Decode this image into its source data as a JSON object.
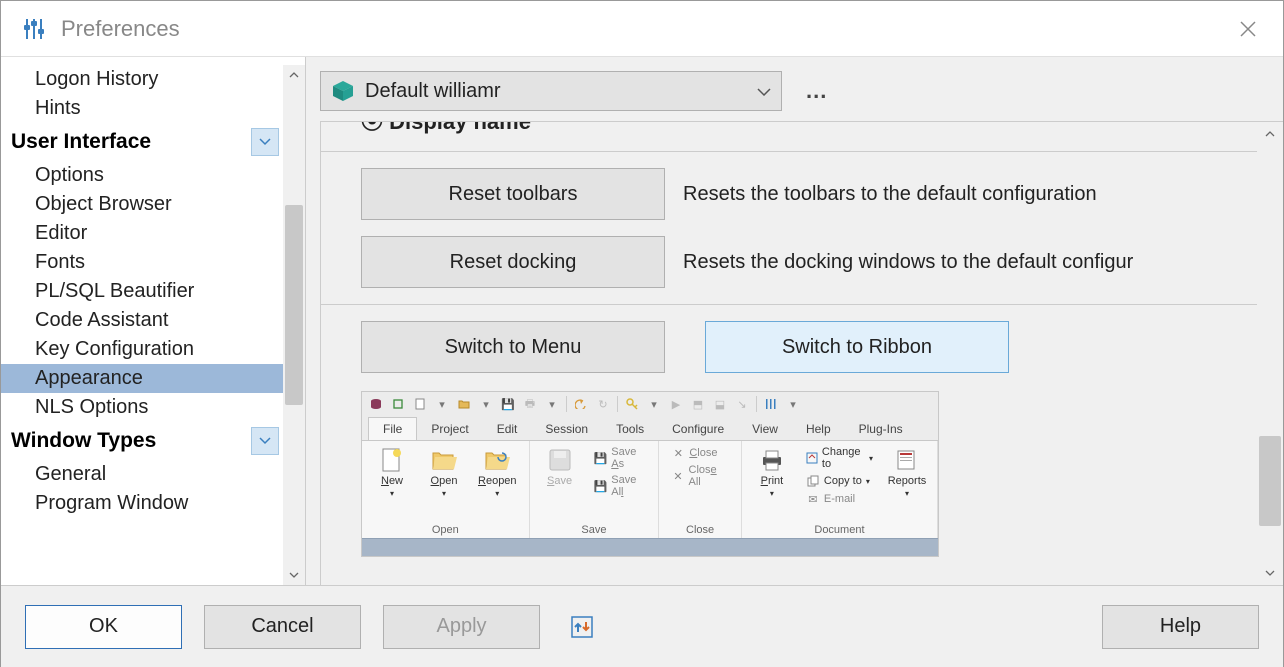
{
  "window": {
    "title": "Preferences"
  },
  "sidebar": {
    "items_above": [
      "Logon History",
      "Hints"
    ],
    "section1": {
      "title": "User Interface",
      "items": [
        "Options",
        "Object Browser",
        "Editor",
        "Fonts",
        "PL/SQL Beautifier",
        "Code Assistant",
        "Key Configuration",
        "Appearance",
        "NLS Options"
      ],
      "selected_index": 7
    },
    "section2": {
      "title": "Window Types",
      "items": [
        "General",
        "Program Window"
      ]
    }
  },
  "profile": {
    "selected": "Default williamr"
  },
  "content": {
    "reset_toolbars_btn": "Reset toolbars",
    "reset_toolbars_desc": "Resets the toolbars to the default configuration",
    "reset_docking_btn": "Reset docking",
    "reset_docking_desc": "Resets the docking windows to the default configur",
    "switch_menu_btn": "Switch to Menu",
    "switch_ribbon_btn": "Switch to Ribbon"
  },
  "ribbon_preview": {
    "tabs": [
      "File",
      "Project",
      "Edit",
      "Session",
      "Tools",
      "Configure",
      "View",
      "Help",
      "Plug-Ins"
    ],
    "active_tab": 0,
    "group_open": {
      "label": "Open",
      "new": "New",
      "open": "Open",
      "reopen": "Reopen"
    },
    "group_save": {
      "label": "Save",
      "save": "Save",
      "save_as": "Save As",
      "save_all": "Save All"
    },
    "group_close": {
      "label": "Close",
      "close": "Close",
      "close_all": "Close All"
    },
    "group_document": {
      "label": "Document",
      "print": "Print",
      "change_to": "Change to",
      "copy_to": "Copy to",
      "email": "E-mail",
      "reports": "Reports"
    }
  },
  "footer": {
    "ok": "OK",
    "cancel": "Cancel",
    "apply": "Apply",
    "help": "Help"
  }
}
